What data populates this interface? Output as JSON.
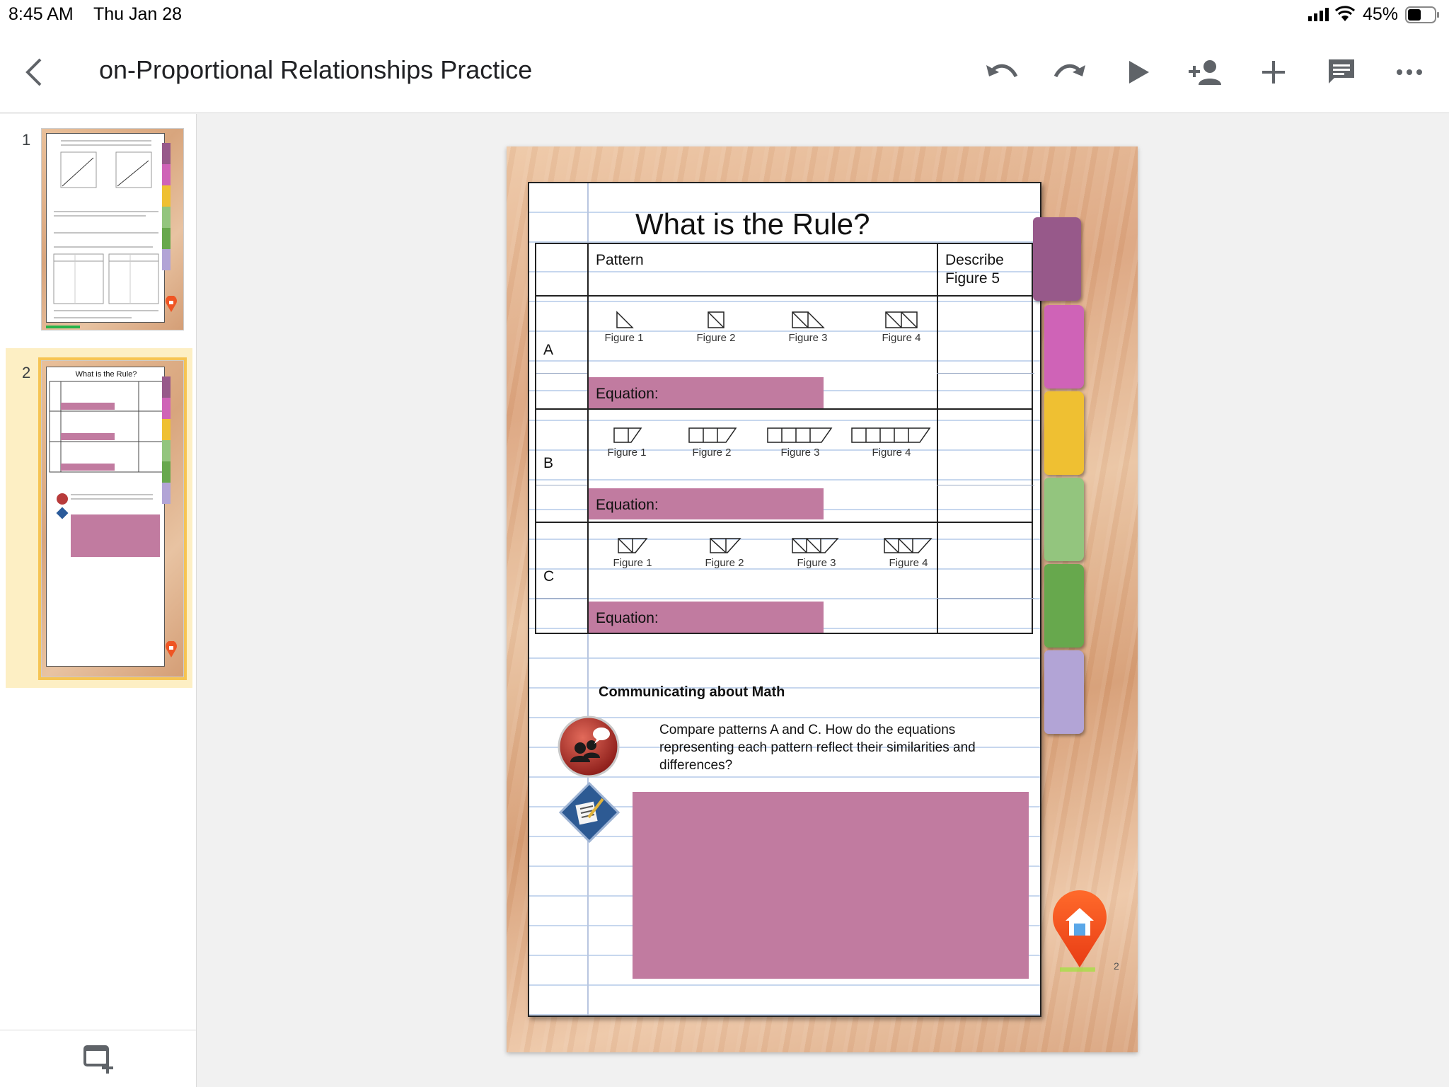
{
  "status_bar": {
    "time": "8:45 AM",
    "date": "Thu Jan 28",
    "battery": "45%"
  },
  "app_bar": {
    "title": "on-Proportional Relationships Practice"
  },
  "toolbar": {
    "icons": [
      "back-icon",
      "undo-icon",
      "redo-icon",
      "present-icon",
      "share-icon",
      "add-icon",
      "comment-icon",
      "more-icon"
    ]
  },
  "sidebar": {
    "slides": [
      {
        "number": "1",
        "selected": false
      },
      {
        "number": "2",
        "selected": true,
        "title": "What is the Rule?"
      }
    ]
  },
  "slide": {
    "title": "What is the Rule?",
    "header": {
      "pattern": "Pattern",
      "describe": "Describe\nFigure 5"
    },
    "rows": [
      {
        "letter": "A",
        "figures": [
          "Figure 1",
          "Figure 2",
          "Figure 3",
          "Figure 4"
        ],
        "equation_label": "Equation:"
      },
      {
        "letter": "B",
        "figures": [
          "Figure 1",
          "Figure 2",
          "Figure 3",
          "Figure 4"
        ],
        "equation_label": "Equation:"
      },
      {
        "letter": "C",
        "figures": [
          "Figure 1",
          "Figure 2",
          "Figure 3",
          "Figure 4"
        ],
        "equation_label": "Equation:"
      }
    ],
    "communicating_title": "Communicating about Math",
    "prompt": "Compare patterns A and C.  How do the equations representing each pattern reflect their similarities and differences?",
    "page_number": "2",
    "tab_colors": [
      "#97598a",
      "#cf63b7",
      "#efc032",
      "#93c57e",
      "#67a84d",
      "#b2a4d6"
    ],
    "answer_box_color": "#c17ba0"
  }
}
